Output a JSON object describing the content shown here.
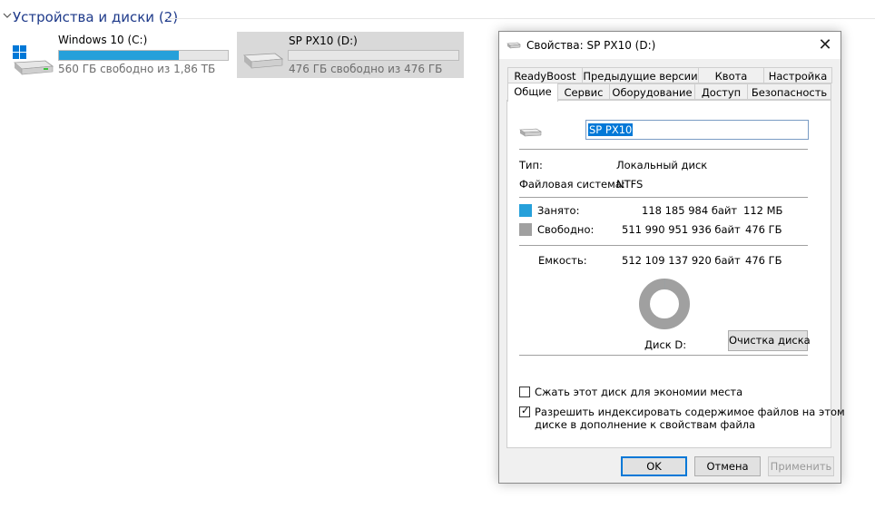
{
  "section": {
    "title": "Устройства и диски (2)",
    "chevron_icon": "chevron-down-icon"
  },
  "drives": [
    {
      "name": "Windows 10 (C:)",
      "info": "560 ГБ свободно из 1,86 ТБ",
      "used_fraction": 0.71,
      "selected": false,
      "icon": "windows-drive-icon"
    },
    {
      "name": "SP PX10 (D:)",
      "info": "476 ГБ свободно из 476 ГБ",
      "used_fraction": 0.0,
      "selected": true,
      "icon": "drive-icon"
    }
  ],
  "dialog": {
    "title": "Свойства: SP PX10 (D:)",
    "close_glyph": "✕",
    "tabs_row1": [
      "ReadyBoost",
      "Предыдущие версии",
      "Квота",
      "Настройка"
    ],
    "tabs_row2": [
      "Общие",
      "Сервис",
      "Оборудование",
      "Доступ",
      "Безопасность"
    ],
    "active_tab": "Общие",
    "general": {
      "drive_name_value": "SP PX10",
      "type_label": "Тип:",
      "type_value": "Локальный диск",
      "fs_label": "Файловая система:",
      "fs_value": "NTFS",
      "used_label": "Занято:",
      "used_bytes": "118 185 984 байт",
      "used_size": "112 МБ",
      "free_label": "Свободно:",
      "free_bytes": "511 990 951 936 байт",
      "free_size": "476 ГБ",
      "capacity_label": "Емкость:",
      "capacity_bytes": "512 109 137 920 байт",
      "capacity_size": "476 ГБ",
      "disk_label": "Диск D:",
      "cleanup_button": "Очистка диска",
      "compress_label": "Сжать этот диск для экономии места",
      "compress_checked": false,
      "index_label_line1": "Разрешить индексировать содержимое файлов на этом",
      "index_label_line2": "диске в дополнение к свойствам файла",
      "index_checked": true
    },
    "buttons": {
      "ok": "OK",
      "cancel": "Отмена",
      "apply": "Применить"
    }
  },
  "colors": {
    "used": "#26a0da",
    "free": "#a0a0a0",
    "accent": "#0078d7",
    "section_title": "#1e3a8a"
  }
}
